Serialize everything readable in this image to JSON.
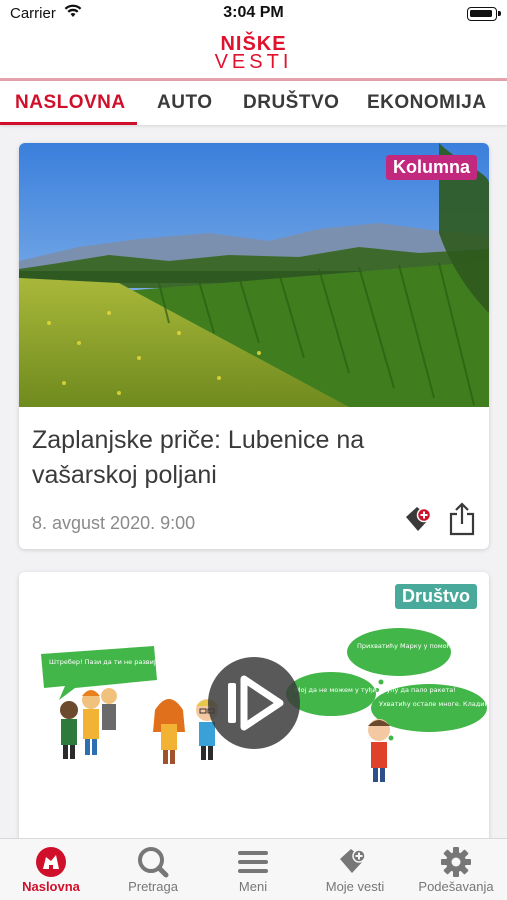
{
  "status_bar": {
    "carrier": "Carrier",
    "time": "3:04 PM"
  },
  "app": {
    "logo_line1": "NIŠKE",
    "logo_line2": "VESTI",
    "brand_color": "#e0122e"
  },
  "tabs": [
    {
      "label": "NASLOVNA",
      "active": true
    },
    {
      "label": "AUTO"
    },
    {
      "label": "DRUŠTVO"
    },
    {
      "label": "EKONOMIJA"
    }
  ],
  "articles": [
    {
      "badge": "Kolumna",
      "badge_color": "#c2287d",
      "title": "Zaplanjske priče: Lubenice na vašarskoj poljani",
      "date": "8. avgust 2020. 9:00",
      "image": "landscape-field-photo"
    },
    {
      "badge": "Društvo",
      "badge_color": "#49a99a",
      "image": "cartoon-video-thumbnail",
      "video": true,
      "bubbles": [
        "Штребер! Пази да ти не развијем тегле!",
        "Мој да не можем у туђи групу да пало ракета!",
        "Прихватићу Марку у помоћ, роба ће Шанету да нађе разговора са њим другом.",
        "Ухватићу остале многе. Кладим се да можете ли да је Шане нисао Пази шефе. и да нам дају нешто."
      ]
    }
  ],
  "tabbar": [
    {
      "label": "Naslovna",
      "icon": "home-logo-icon",
      "active": true
    },
    {
      "label": "Pretraga",
      "icon": "search-icon"
    },
    {
      "label": "Meni",
      "icon": "menu-icon"
    },
    {
      "label": "Moje vesti",
      "icon": "bookmark-add-icon"
    },
    {
      "label": "Podešavanja",
      "icon": "gear-icon"
    }
  ]
}
